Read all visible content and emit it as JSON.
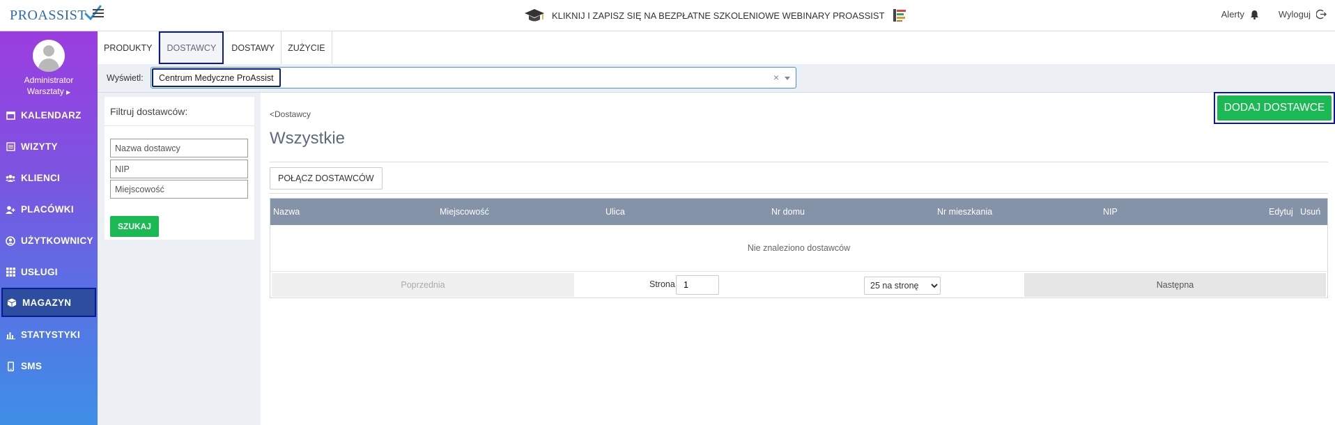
{
  "header": {
    "logo_text": "PROASSIST",
    "banner_text": "KLIKNIJ I ZAPISZ SIĘ NA BEZPŁATNE SZKOLENIOWE WEBINARY PROASSIST",
    "alerts_label": "Alerty",
    "logout_label": "Wyloguj"
  },
  "sidebar": {
    "user_name": "Administrator",
    "user_sub": "Warsztaty",
    "items": [
      {
        "label": "KALENDARZ",
        "icon": "calendar-icon"
      },
      {
        "label": "WIZYTY",
        "icon": "list-icon"
      },
      {
        "label": "KLIENCI",
        "icon": "users-icon"
      },
      {
        "label": "PLACÓWKI",
        "icon": "user-add-icon"
      },
      {
        "label": "UŻYTKOWNICY",
        "icon": "user-circle-icon"
      },
      {
        "label": "USŁUGI",
        "icon": "grid-icon"
      },
      {
        "label": "MAGAZYN",
        "icon": "box-icon"
      },
      {
        "label": "STATYSTYKI",
        "icon": "bar-chart-icon"
      },
      {
        "label": "SMS",
        "icon": "phone-icon"
      }
    ],
    "active_item": "MAGAZYN"
  },
  "tabs": [
    {
      "label": "PRODUKTY"
    },
    {
      "label": "DOSTAWCY"
    },
    {
      "label": "DOSTAWY"
    },
    {
      "label": "ZUŻYCIE"
    }
  ],
  "active_tab": "DOSTAWCY",
  "display": {
    "label": "Wyświetl:",
    "selected": "Centrum Medyczne ProAssist"
  },
  "filter": {
    "title": "Filtruj dostawców:",
    "name_placeholder": "Nazwa dostawcy",
    "nip_placeholder": "NIP",
    "city_placeholder": "Miejscowość",
    "search_label": "SZUKAJ"
  },
  "main": {
    "breadcrumb": "<Dostawcy",
    "title": "Wszystkie",
    "add_button": "DODAJ DOSTAWCE",
    "merge_button": "POŁĄCZ DOSTAWCÓW"
  },
  "table": {
    "columns": [
      "Nazwa",
      "Miejscowość",
      "Ulica",
      "Nr domu",
      "Nr mieszkania",
      "NIP",
      "Edytuj",
      "Usuń"
    ],
    "empty_text": "Nie znaleziono dostawców"
  },
  "pager": {
    "prev_label": "Poprzednia",
    "page_label": "Strona",
    "page_value": "1",
    "per_page": "25 na stronę",
    "next_label": "Następna"
  },
  "colors": {
    "sidebar_top": "#9b3de0",
    "sidebar_bottom": "#3d8fe6",
    "accent_green": "#1bb954",
    "table_header": "#8593a8",
    "highlight_border": "#0a1a8f"
  }
}
